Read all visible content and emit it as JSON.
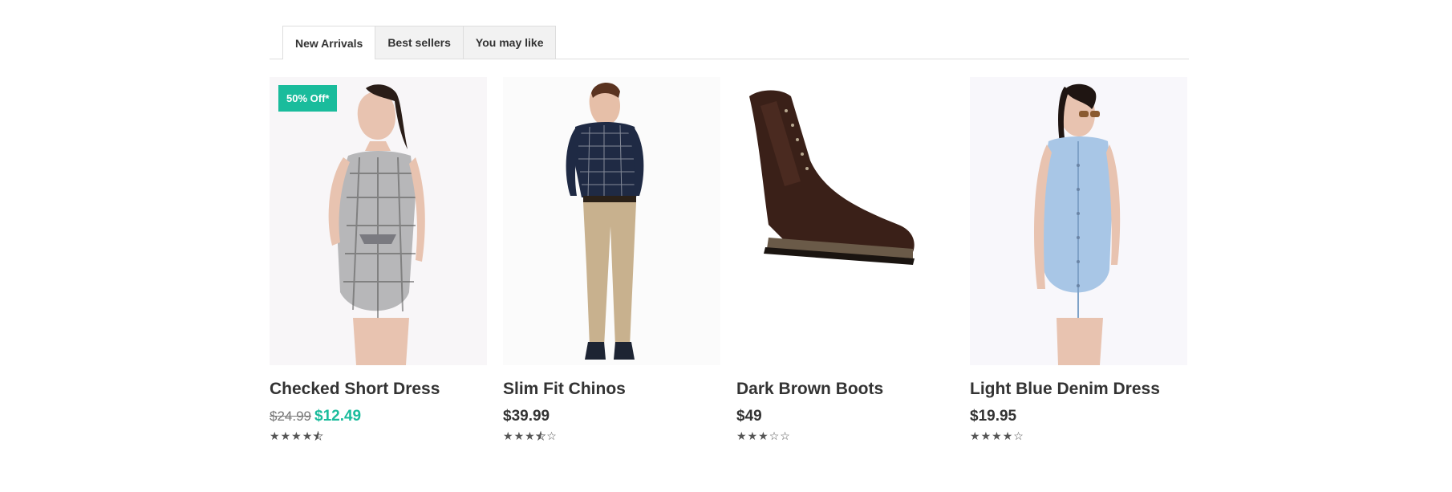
{
  "tabs": [
    {
      "label": "New Arrivals",
      "active": true
    },
    {
      "label": "Best sellers",
      "active": false
    },
    {
      "label": "You may like",
      "active": false
    }
  ],
  "products": [
    {
      "name": "Checked Short Dress",
      "old_price": "$24.99",
      "price": "$12.49",
      "badge": "50% Off*",
      "rating": 4.5
    },
    {
      "name": "Slim Fit Chinos",
      "price": "$39.99",
      "rating": 3.5
    },
    {
      "name": "Dark Brown Boots",
      "price": "$49",
      "rating": 3
    },
    {
      "name": "Light Blue Denim Dress",
      "price": "$19.95",
      "rating": 4
    }
  ],
  "colors": {
    "accent": "#1abc9c",
    "text": "#333333",
    "star": "#555555"
  }
}
